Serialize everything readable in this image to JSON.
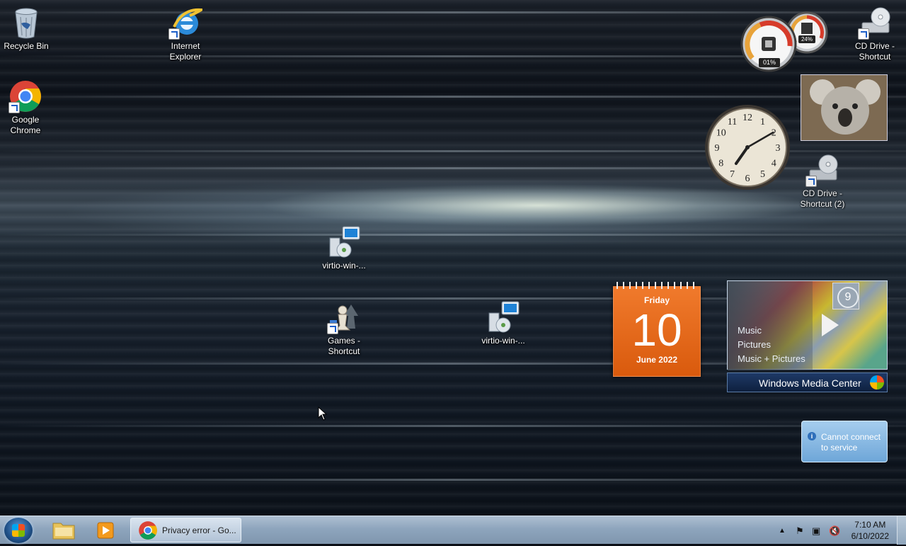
{
  "desktop": {
    "icons": [
      {
        "label": "Recycle Bin"
      },
      {
        "label": "Internet Explorer"
      },
      {
        "label": "Google Chrome"
      },
      {
        "label": "CD Drive - Shortcut"
      },
      {
        "label": "CD Drive - Shortcut (2)"
      },
      {
        "label": "virtio-win-..."
      },
      {
        "label": "Games - Shortcut"
      },
      {
        "label": "virtio-win-..."
      }
    ]
  },
  "gadgets": {
    "cpu_meter": {
      "cpu": "01%",
      "memory": "24%"
    },
    "clock": {
      "numbers": [
        "12",
        "1",
        "2",
        "3",
        "4",
        "5",
        "6",
        "7",
        "8",
        "9",
        "10",
        "11"
      ],
      "hour": 7,
      "minute": 10
    },
    "calendar": {
      "weekday": "Friday",
      "day": "10",
      "month_year": "June 2022"
    },
    "media_center": {
      "menu": [
        "Music",
        "Pictures",
        "Music + Pictures"
      ],
      "brand": "Windows Media Center",
      "tile_number": "9"
    },
    "feed": {
      "message": "Cannot connect to service"
    }
  },
  "taskbar": {
    "active_window": {
      "title": "Privacy error - Go..."
    },
    "tray": {
      "time": "7:10 AM",
      "date": "6/10/2022"
    }
  },
  "colors": {
    "calendar": "#e8661a",
    "taskbar": "#8ea5bd",
    "feed": "#6ea6d8"
  }
}
